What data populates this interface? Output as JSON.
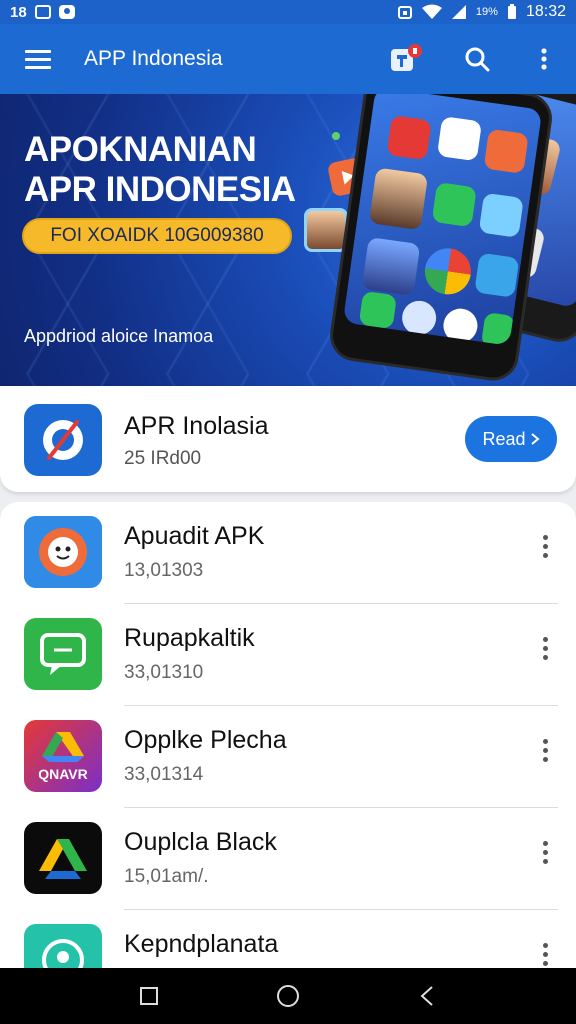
{
  "status_bar": {
    "left_text": "18",
    "battery": "19%",
    "time": "18:32"
  },
  "app_bar": {
    "title": "APP Indonesia",
    "icons": [
      "menu-icon",
      "notification-badge-icon",
      "search-icon",
      "more-vert-icon"
    ]
  },
  "banner": {
    "title_line1": "APOKNANIAN",
    "title_line2": "APR INDONESIA",
    "promo": "FOI XOAIDK 10G009380",
    "subtitle": "Appdriod aloice Inamoa"
  },
  "featured": {
    "name": "APR Inolasia",
    "subtitle": "25 IRd00",
    "button": "Read"
  },
  "apps": [
    {
      "name": "Apuadit APK",
      "sub": "13,01303"
    },
    {
      "name": "Rupapkaltik",
      "sub": "33,01310"
    },
    {
      "name": "Opplke Plecha",
      "sub": "33,01314",
      "icon_text": "QNAVR"
    },
    {
      "name": "Ouplcla Black",
      "sub": "15,01am/."
    },
    {
      "name": "Kepndplanata",
      "sub": ""
    }
  ],
  "colors": {
    "primary": "#1e6ad3",
    "accent": "#f5b92a",
    "button": "#1c74e0"
  }
}
